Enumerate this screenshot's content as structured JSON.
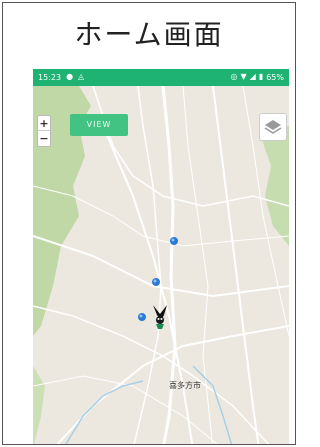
{
  "page": {
    "heading": "ホーム画面"
  },
  "status_bar": {
    "time": "15:23",
    "left_icons": [
      "notification-icon",
      "alert-icon"
    ],
    "right_icons": [
      "location-icon",
      "wifi-icon",
      "signal-icon",
      "battery-icon"
    ],
    "battery": "65%",
    "color": "#1eb373"
  },
  "map": {
    "view_button": "VIEW",
    "zoom_in": "+",
    "zoom_out": "−",
    "city_label": "喜多方市",
    "colors": {
      "land": "#ece8df",
      "forest": "#bfd8a6",
      "road": "#ffffff",
      "river": "#a8cfe8",
      "marker": "#2a7ad6",
      "accent": "#43c383"
    }
  }
}
